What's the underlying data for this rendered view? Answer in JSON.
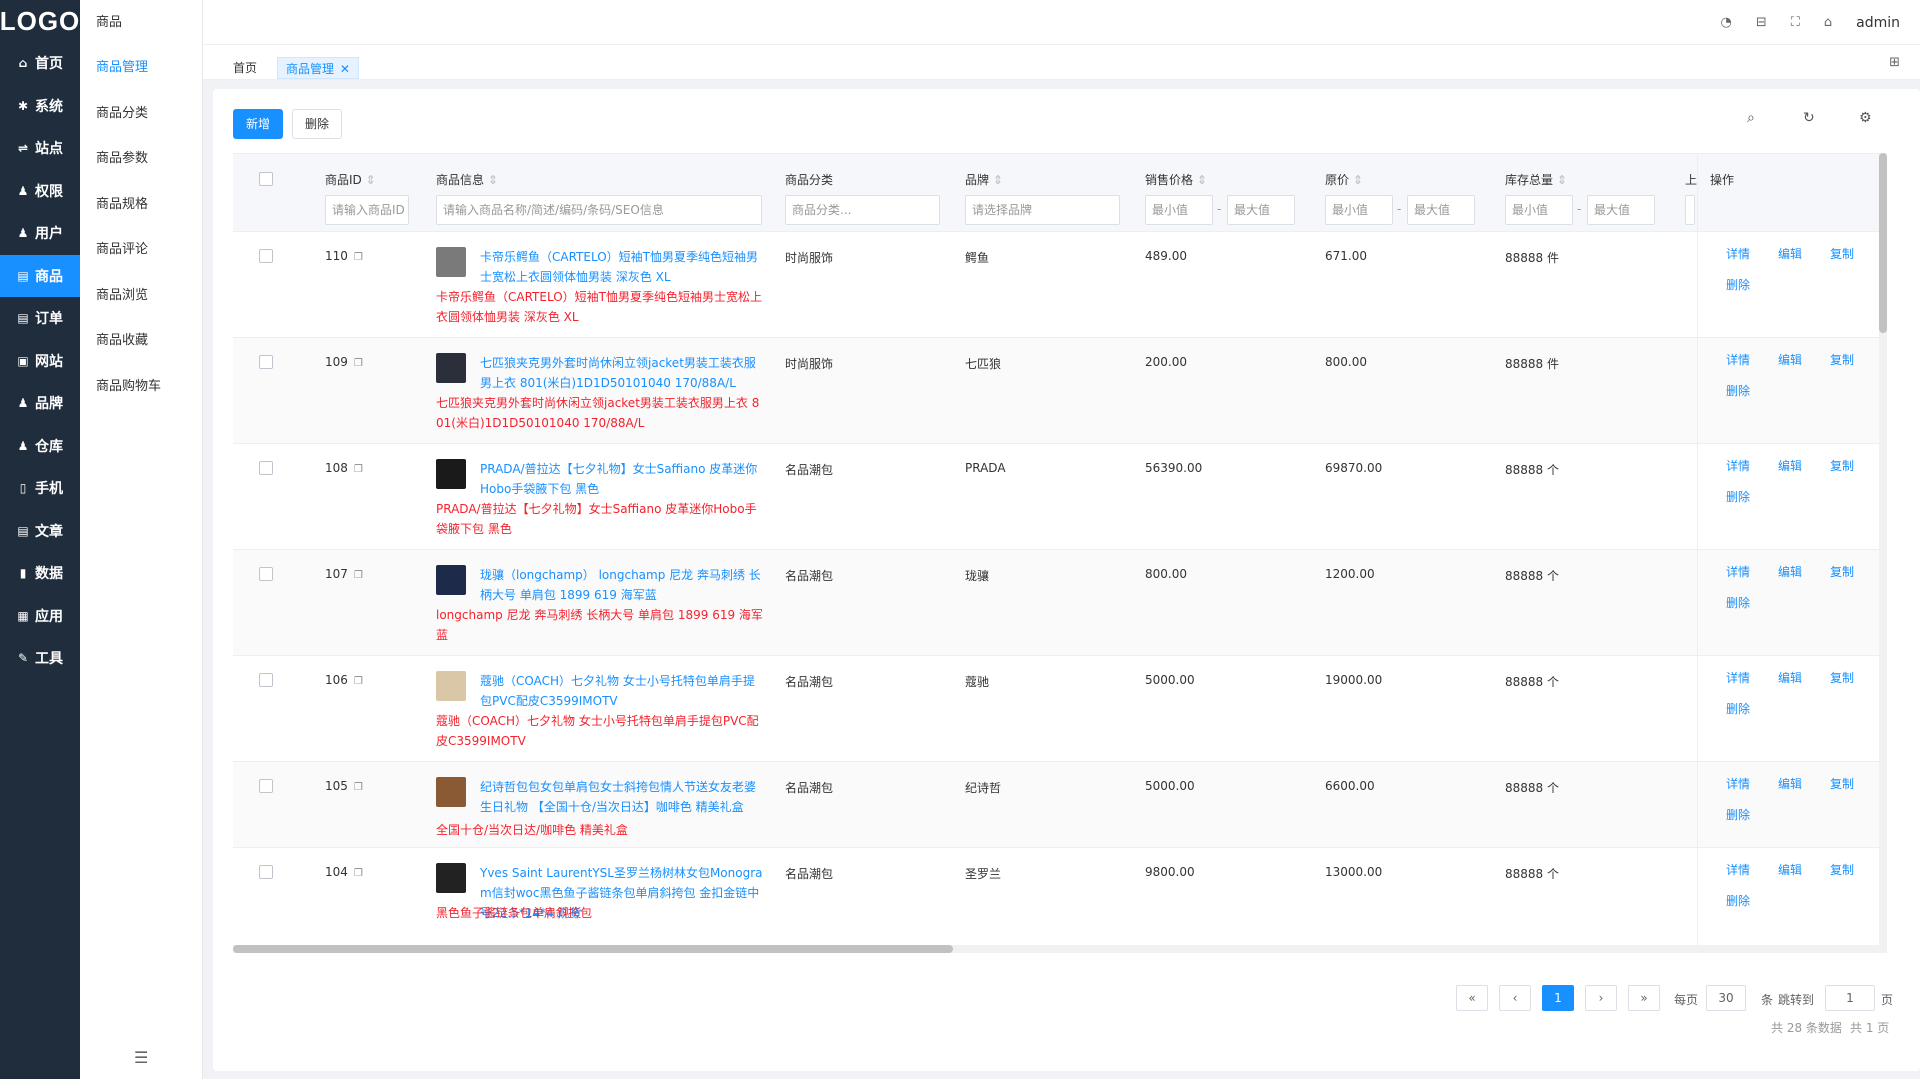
{
  "app": {
    "logo": "LOGO",
    "user": "admin"
  },
  "nav": [
    {
      "label": "首页",
      "icon": "home-icon",
      "glyph": "⌂"
    },
    {
      "label": "系统",
      "icon": "gear-icon",
      "glyph": "✱"
    },
    {
      "label": "站点",
      "icon": "sliders-icon",
      "glyph": "⇌"
    },
    {
      "label": "权限",
      "icon": "user-shield-icon",
      "glyph": "♟"
    },
    {
      "label": "用户",
      "icon": "user-icon",
      "glyph": "♟"
    },
    {
      "label": "商品",
      "icon": "product-icon",
      "glyph": "▤"
    },
    {
      "label": "订单",
      "icon": "order-icon",
      "glyph": "▤"
    },
    {
      "label": "网站",
      "icon": "website-icon",
      "glyph": "▣"
    },
    {
      "label": "品牌",
      "icon": "brand-icon",
      "glyph": "♟"
    },
    {
      "label": "仓库",
      "icon": "warehouse-icon",
      "glyph": "♟"
    },
    {
      "label": "手机",
      "icon": "phone-icon",
      "glyph": "▯"
    },
    {
      "label": "文章",
      "icon": "article-icon",
      "glyph": "▤"
    },
    {
      "label": "数据",
      "icon": "chart-icon",
      "glyph": "▮"
    },
    {
      "label": "应用",
      "icon": "apps-icon",
      "glyph": "▦"
    },
    {
      "label": "工具",
      "icon": "wrench-icon",
      "glyph": "✎"
    }
  ],
  "submenu": {
    "title": "商品",
    "items": [
      "商品管理",
      "商品分类",
      "商品参数",
      "商品规格",
      "商品评论",
      "商品浏览",
      "商品收藏",
      "商品购物车"
    ]
  },
  "tabs": {
    "home": "首页",
    "current": "商品管理",
    "close": "✕"
  },
  "toolbar": {
    "add": "新增",
    "delete": "删除"
  },
  "columns": {
    "id": "商品ID",
    "info": "商品信息",
    "category": "商品分类",
    "brand": "品牌",
    "price": "销售价格",
    "orig_price": "原价",
    "stock": "库存总量",
    "shelf": "上",
    "ops": "操作"
  },
  "filters": {
    "id": "请输入商品ID",
    "info": "请输入商品名称/简述/编码/条码/SEO信息",
    "category": "商品分类...",
    "brand": "请选择品牌",
    "min": "最小值",
    "max": "最大值",
    "sep": "-"
  },
  "ops": {
    "detail": "详情",
    "edit": "编辑",
    "copy": "复制",
    "delete": "删除"
  },
  "rows": [
    {
      "id": "110",
      "name": "卡帝乐鳄鱼（CARTELO）短袖T恤男夏季纯色短袖男士宽松上衣圆领体恤男装 深灰色 XL",
      "seo": "卡帝乐鳄鱼（CARTELO）短袖T恤男夏季纯色短袖男士宽松上衣圆领体恤男装 深灰色 XL",
      "category": "时尚服饰",
      "brand": "鳄鱼",
      "price": "489.00",
      "orig": "671.00",
      "stock": "88888 件",
      "thumb": "#7a7a7a"
    },
    {
      "id": "109",
      "name": "七匹狼夹克男外套时尚休闲立领jacket男装工装衣服男上衣 801(米白)1D1D50101040 170/88A/L",
      "seo": "七匹狼夹克男外套时尚休闲立领jacket男装工装衣服男上衣 801(米白)1D1D50101040 170/88A/L",
      "category": "时尚服饰",
      "brand": "七匹狼",
      "price": "200.00",
      "orig": "800.00",
      "stock": "88888 件",
      "thumb": "#2b2f3a"
    },
    {
      "id": "108",
      "name": "PRADA/普拉达【七夕礼物】女士Saffiano 皮革迷你Hobo手袋腋下包 黑色",
      "seo": "PRADA/普拉达【七夕礼物】女士Saffiano 皮革迷你Hobo手袋腋下包 黑色",
      "category": "名品潮包",
      "brand": "PRADA",
      "price": "56390.00",
      "orig": "69870.00",
      "stock": "88888 个",
      "thumb": "#1a1a1a"
    },
    {
      "id": "107",
      "name": "珑骧（longchamp） longchamp 尼龙 奔马刺绣 长柄大号 单肩包 1899 619 海军蓝",
      "seo": "longchamp 尼龙 奔马刺绣 长柄大号 单肩包 1899 619 海军蓝",
      "category": "名品潮包",
      "brand": "珑骧",
      "price": "800.00",
      "orig": "1200.00",
      "stock": "88888 个",
      "thumb": "#1d2a4a"
    },
    {
      "id": "106",
      "name": "蔻驰（COACH）七夕礼物 女士小号托特包单肩手提包PVC配皮C3599IMOTV",
      "seo": "蔻驰（COACH）七夕礼物 女士小号托特包单肩手提包PVC配皮C3599IMOTV",
      "category": "名品潮包",
      "brand": "蔻驰",
      "price": "5000.00",
      "orig": "19000.00",
      "stock": "88888 个",
      "thumb": "#d9c7a8"
    },
    {
      "id": "105",
      "name": "纪诗哲包包女包单肩包女士斜挎包情人节送女友老婆生日礼物 【全国十仓/当次日达】咖啡色 精美礼盒",
      "seo": "全国十仓/当次日达/咖啡色 精美礼盒",
      "category": "名品潮包",
      "brand": "纪诗哲",
      "price": "5000.00",
      "orig": "6600.00",
      "stock": "88888 个",
      "thumb": "#8a5a34"
    },
    {
      "id": "104",
      "name": "Yves Saint LaurentYSL圣罗兰杨树林女包Monogram信封woc黑色鱼子酱链条包单肩斜挎包 金扣金链中号22.5*14*4 现货",
      "seo": "黑色鱼子酱链条包单肩斜挎包",
      "category": "名品潮包",
      "brand": "圣罗兰",
      "price": "9800.00",
      "orig": "13000.00",
      "stock": "88888 个",
      "thumb": "#222222"
    }
  ],
  "pagination": {
    "first": "«",
    "prev": "‹",
    "current": "1",
    "next": "›",
    "last": "»",
    "per_page_label": "每页",
    "per_page": "30",
    "per_page_unit": "条",
    "jump_label": "跳转到",
    "jump_value": "1",
    "jump_unit": "页",
    "total": "共 28 条数据",
    "pages": "共 1 页"
  },
  "colors": {
    "accent": "#1890ff",
    "sidebar": "#1f2d3d",
    "danger": "#f5222d"
  }
}
